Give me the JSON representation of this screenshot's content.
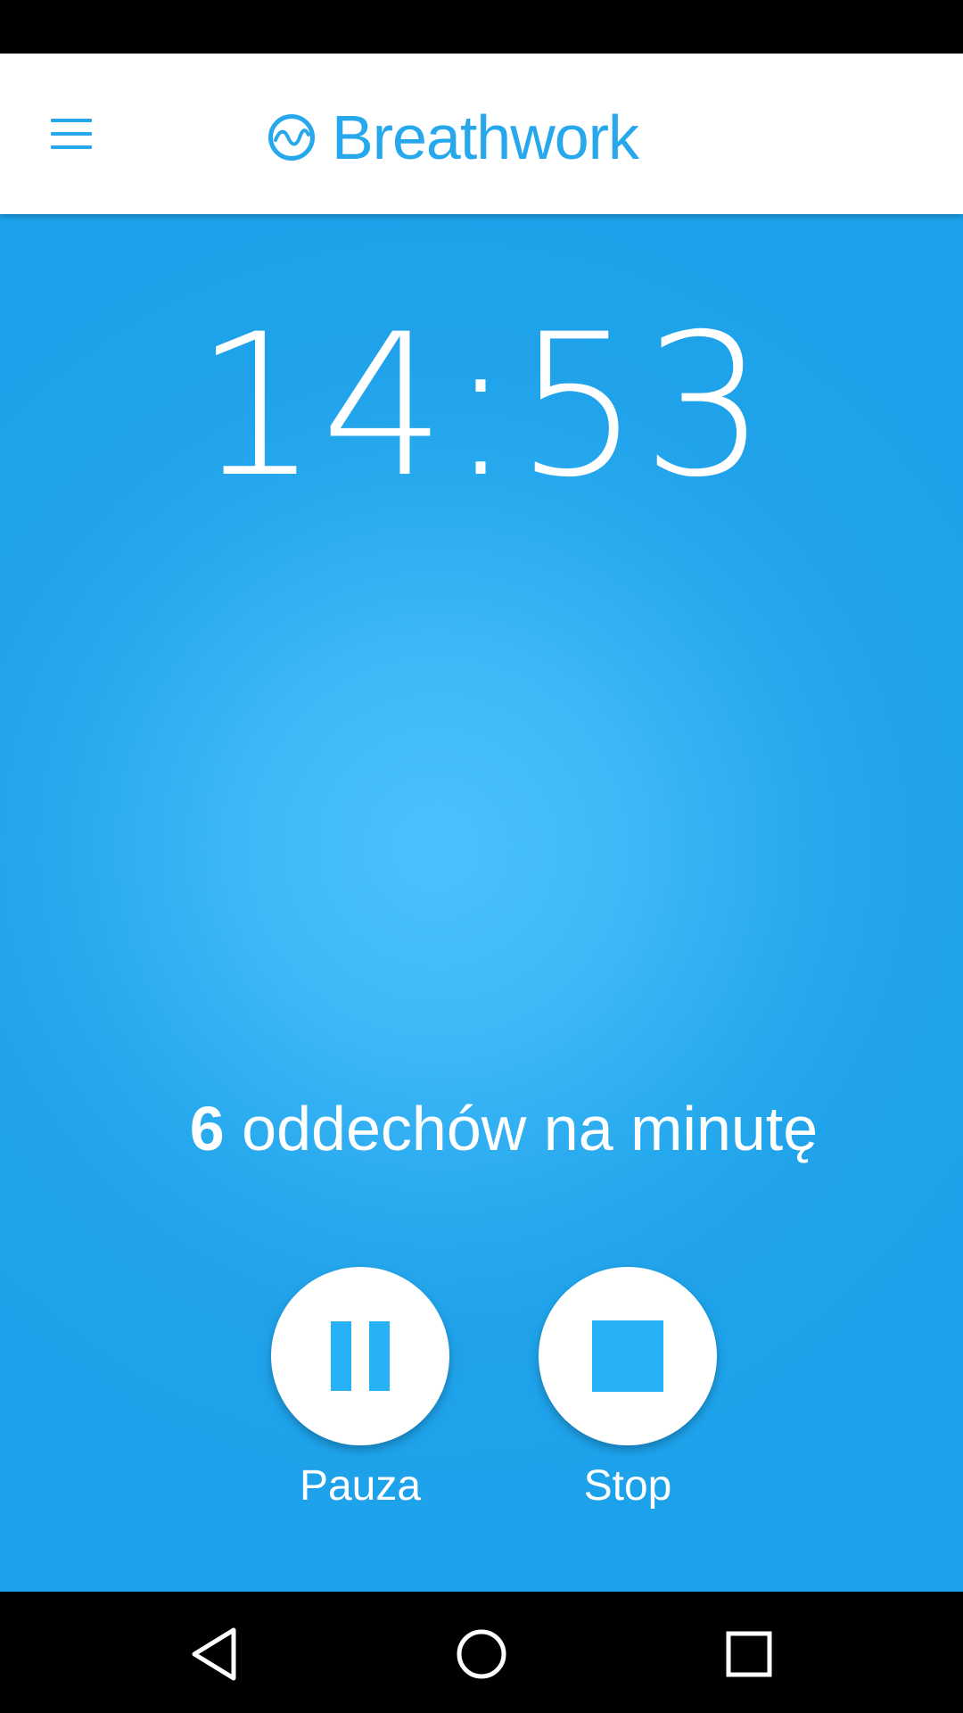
{
  "app": {
    "title": "Breathwork",
    "accent_color": "#27a8ec"
  },
  "app_bar": {
    "menu_icon": "hamburger-menu-icon",
    "logo_icon": "wave-circle-logo-icon"
  },
  "session": {
    "timer": "14:53",
    "breaths_per_minute": "6",
    "rate_text": " oddechów na minutę"
  },
  "controls": {
    "pause_label": "Pauza",
    "pause_icon": "pause-icon",
    "stop_label": "Stop",
    "stop_icon": "stop-icon"
  },
  "nav_bar": {
    "back_icon": "back-triangle-icon",
    "home_icon": "home-circle-icon",
    "recents_icon": "recents-square-icon"
  }
}
